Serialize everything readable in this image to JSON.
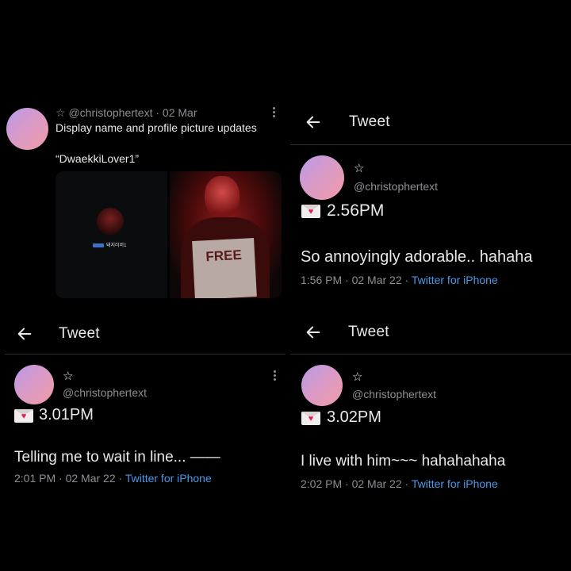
{
  "panel1": {
    "handle": "☆ @christophertext · 02 Mar",
    "text": "Display name and profile picture updates",
    "quote": "“DwaekkiLover1”",
    "mini_name": "돼지러버1",
    "sign_text": "FREE"
  },
  "panel2": {
    "header": "Tweet",
    "star": "☆",
    "handle": "@christophertext",
    "time_label": "2.56PM",
    "text": "So annoyingly adorable.. hahaha",
    "meta": "1:56 PM · 02 Mar 22 · ",
    "source": "Twitter for iPhone"
  },
  "panel3": {
    "header": "Tweet",
    "star": "☆",
    "handle": "@christophertext",
    "time_label": "3.01PM",
    "text": "Telling me to wait in line... ——",
    "meta": "2:01 PM · 02 Mar 22 · ",
    "source": "Twitter for iPhone"
  },
  "panel4": {
    "header": "Tweet",
    "star": "☆",
    "handle": "@christophertext",
    "time_label": "3.02PM",
    "text": "I live with him~~~ hahahahaha",
    "meta": "2:02 PM · 02 Mar 22 · ",
    "source": "Twitter for iPhone"
  },
  "icons": {
    "back": "arrow-left-icon",
    "more": "more-vertical-icon",
    "envelope": "love-letter-icon"
  },
  "colors": {
    "background": "#000000",
    "text": "#e7e9ea",
    "muted": "#8b8f94",
    "link": "#4a99e9"
  }
}
